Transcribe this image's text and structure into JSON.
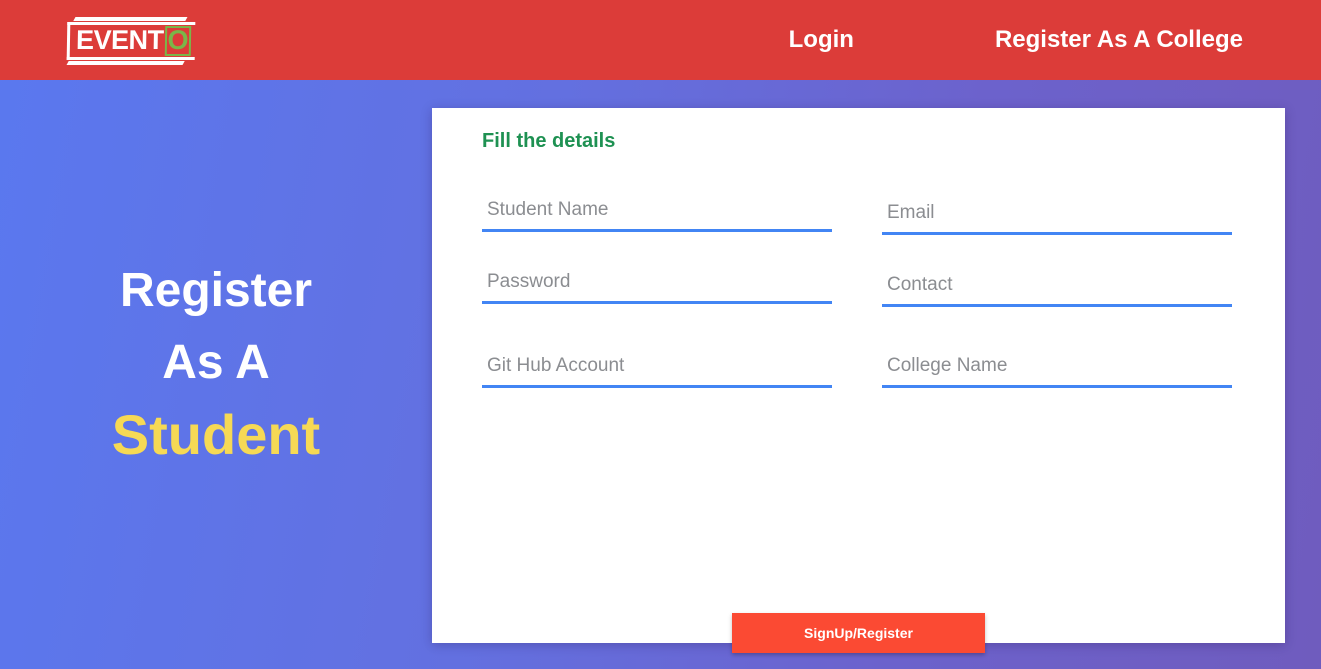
{
  "navbar": {
    "logo": {
      "text_main": "EVENT",
      "text_accent": "O",
      "accent_color": "#7ab648"
    },
    "links": [
      {
        "label": "Login",
        "name": "nav-link-login"
      },
      {
        "label": "Register As A College",
        "name": "nav-link-register-college"
      }
    ],
    "background_color": "#dc3c39"
  },
  "hero": {
    "line1": "Register",
    "line2": "As A",
    "line3": "Student",
    "line3_color": "#f6d955"
  },
  "card": {
    "title": "Fill the details",
    "title_color": "#1e9152",
    "fields": [
      {
        "name": "student-name-input",
        "placeholder": "Student Name",
        "value": "",
        "type": "text",
        "column": "left",
        "row": 1
      },
      {
        "name": "email-input",
        "placeholder": "Email",
        "value": "",
        "type": "text",
        "column": "right",
        "row": 1
      },
      {
        "name": "password-input",
        "placeholder": "Password",
        "value": "",
        "type": "password",
        "column": "left",
        "row": 2
      },
      {
        "name": "contact-input",
        "placeholder": "Contact",
        "value": "",
        "type": "text",
        "column": "right",
        "row": 2
      },
      {
        "name": "github-input",
        "placeholder": "Git Hub Account",
        "value": "",
        "type": "text",
        "column": "left",
        "row": 3
      },
      {
        "name": "college-name-input",
        "placeholder": "College Name",
        "value": "",
        "type": "text",
        "column": "right",
        "row": 3
      }
    ],
    "submit_label": "SignUp/Register",
    "submit_color": "#fb4a33",
    "input_underline_color": "#4285f4"
  },
  "background": {
    "gradient_from": "#5a78ef",
    "gradient_to": "#6f5cbe"
  }
}
